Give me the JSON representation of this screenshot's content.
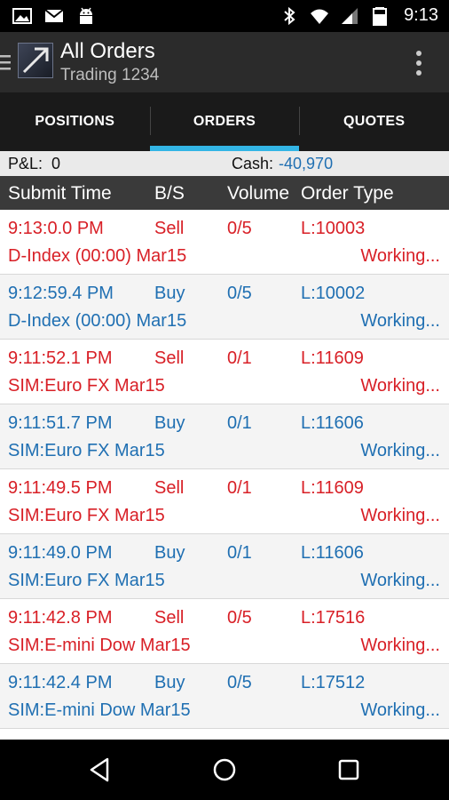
{
  "status_bar": {
    "time": "9:13",
    "left_icons": [
      "image-icon",
      "gmail-icon",
      "android-icon"
    ],
    "right_icons": [
      "bluetooth-icon",
      "wifi-icon",
      "signal-icon",
      "battery-icon"
    ]
  },
  "action_bar": {
    "title": "All Orders",
    "subtitle": "Trading 1234"
  },
  "tabs": [
    {
      "label": "POSITIONS",
      "active": false
    },
    {
      "label": "ORDERS",
      "active": true
    },
    {
      "label": "QUOTES",
      "active": false
    }
  ],
  "summary": {
    "pnl_label": "P&L:",
    "pnl_value": "0",
    "cash_label": "Cash:",
    "cash_value": "-40,970"
  },
  "columns": {
    "submit_time": "Submit Time",
    "bs": "B/S",
    "volume": "Volume",
    "order_type": "Order Type"
  },
  "orders": [
    {
      "time": "9:13:0.0 PM",
      "side": "Sell",
      "volume": "0/5",
      "type": "L:10003",
      "instrument": "D-Index (00:00) Mar15",
      "status": "Working..."
    },
    {
      "time": "9:12:59.4 PM",
      "side": "Buy",
      "volume": "0/5",
      "type": "L:10002",
      "instrument": "D-Index (00:00) Mar15",
      "status": "Working..."
    },
    {
      "time": "9:11:52.1 PM",
      "side": "Sell",
      "volume": "0/1",
      "type": "L:11609",
      "instrument": "SIM:Euro FX Mar15",
      "status": "Working..."
    },
    {
      "time": "9:11:51.7 PM",
      "side": "Buy",
      "volume": "0/1",
      "type": "L:11606",
      "instrument": "SIM:Euro FX Mar15",
      "status": "Working..."
    },
    {
      "time": "9:11:49.5 PM",
      "side": "Sell",
      "volume": "0/1",
      "type": "L:11609",
      "instrument": "SIM:Euro FX Mar15",
      "status": "Working..."
    },
    {
      "time": "9:11:49.0 PM",
      "side": "Buy",
      "volume": "0/1",
      "type": "L:11606",
      "instrument": "SIM:Euro FX Mar15",
      "status": "Working..."
    },
    {
      "time": "9:11:42.8 PM",
      "side": "Sell",
      "volume": "0/5",
      "type": "L:17516",
      "instrument": "SIM:E-mini Dow Mar15",
      "status": "Working..."
    },
    {
      "time": "9:11:42.4 PM",
      "side": "Buy",
      "volume": "0/5",
      "type": "L:17512",
      "instrument": "SIM:E-mini Dow Mar15",
      "status": "Working..."
    }
  ],
  "nav_bar": {
    "buttons": [
      "back-icon",
      "home-icon",
      "recents-icon"
    ]
  },
  "colors": {
    "sell": "#d81f26",
    "buy": "#1f6fb2",
    "accent": "#33b5e5"
  }
}
